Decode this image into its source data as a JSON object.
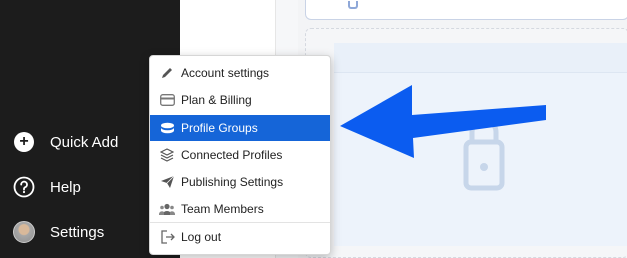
{
  "sidebar": {
    "quick_add": "Quick Add",
    "help": "Help",
    "settings": "Settings"
  },
  "menu": {
    "items": [
      {
        "label": "Account settings",
        "icon": "pencil-icon"
      },
      {
        "label": "Plan & Billing",
        "icon": "credit-card-icon"
      },
      {
        "label": "Profile Groups",
        "icon": "stack-icon",
        "active": true
      },
      {
        "label": "Connected Profiles",
        "icon": "layers-icon"
      },
      {
        "label": "Publishing Settings",
        "icon": "paper-plane-icon"
      },
      {
        "label": "Team Members",
        "icon": "users-icon"
      },
      {
        "label": "Log out",
        "icon": "logout-icon"
      }
    ]
  },
  "colors": {
    "sidebar_bg": "#1c1c1c",
    "active_item": "#1565d8",
    "arrow": "#0b5cf0",
    "lock": "#c7d6ea"
  }
}
